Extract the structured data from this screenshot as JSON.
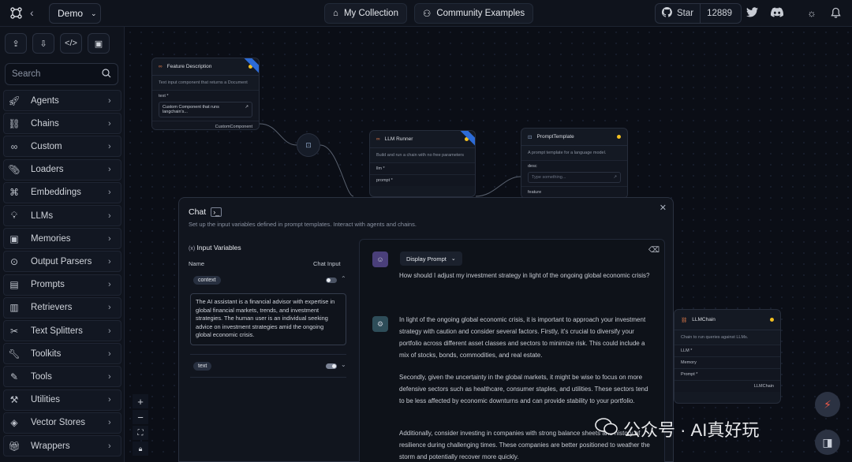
{
  "header": {
    "project_name": "Demo",
    "nav": [
      "My Collection",
      "Community Examples"
    ],
    "github_star_label": "Star",
    "github_star_count": "12889"
  },
  "sidebar": {
    "search_placeholder": "Search",
    "categories": [
      "Agents",
      "Chains",
      "Custom",
      "Loaders",
      "Embeddings",
      "LLMs",
      "Memories",
      "Output Parsers",
      "Prompts",
      "Retrievers",
      "Text Splitters",
      "Toolkits",
      "Tools",
      "Utilities",
      "Vector Stores",
      "Wrappers"
    ]
  },
  "nodes": {
    "feature": {
      "title": "Feature Description",
      "desc": "Text input component that returns a Document",
      "field_label": "text *",
      "field_value": "Custom Component that runs langchain's...",
      "output": "CustomComponent"
    },
    "llm_runner": {
      "title": "LLM Runner",
      "desc": "Build and run a chain with no free parameters",
      "in1": "llm *",
      "in2": "prompt *"
    },
    "prompt_template": {
      "title": "PromptTemplate",
      "desc": "A prompt template for a language model.",
      "field_label": "desc",
      "field_placeholder": "Type something...",
      "field2": "feature"
    },
    "llmchain": {
      "title": "LLMChain",
      "desc": "Chain to run queries against LLMs.",
      "in1": "LLM *",
      "in2": "Memory",
      "in3": "Prompt *",
      "output": "LLMChain"
    }
  },
  "chat": {
    "title": "Chat",
    "subtitle": "Set up the input variables defined in prompt templates. Interact with agents and chains.",
    "input_variables_label": "Input Variables",
    "col_name": "Name",
    "col_chat_input": "Chat Input",
    "var1_name": "context",
    "var1_value": "The AI assistant is a financial advisor with expertise in global financial markets, trends, and investment strategies. The human user is an individual seeking advice on investment strategies amid the ongoing global economic crisis.",
    "var2_name": "text",
    "display_prompt": "Display Prompt",
    "user_message": "How should I adjust my investment strategy in light of the ongoing global economic crisis?",
    "bot_p1": "In light of the ongoing global economic crisis, it is important to approach your investment strategy with caution and consider several factors. Firstly, it's crucial to diversify your portfolio across different asset classes and sectors to minimize risk. This could include a mix of stocks, bonds, commodities, and real estate.",
    "bot_p2": "Secondly, given the uncertainty in the global markets, it might be wise to focus on more defensive sectors such as healthcare, consumer staples, and utilities. These sectors tend to be less affected by economic downturns and can provide stability to your portfolio.",
    "bot_p3": "Additionally, consider investing in companies with strong balance sheets and history of resilience during challenging times. These companies are better positioned to weather the storm and potentially recover more quickly."
  },
  "watermark": "公众号 · AI真好玩",
  "colors": {
    "accent_dot": "#f4c020",
    "ribbon": "#2d6bd6",
    "flash": "#ef5a4a"
  }
}
